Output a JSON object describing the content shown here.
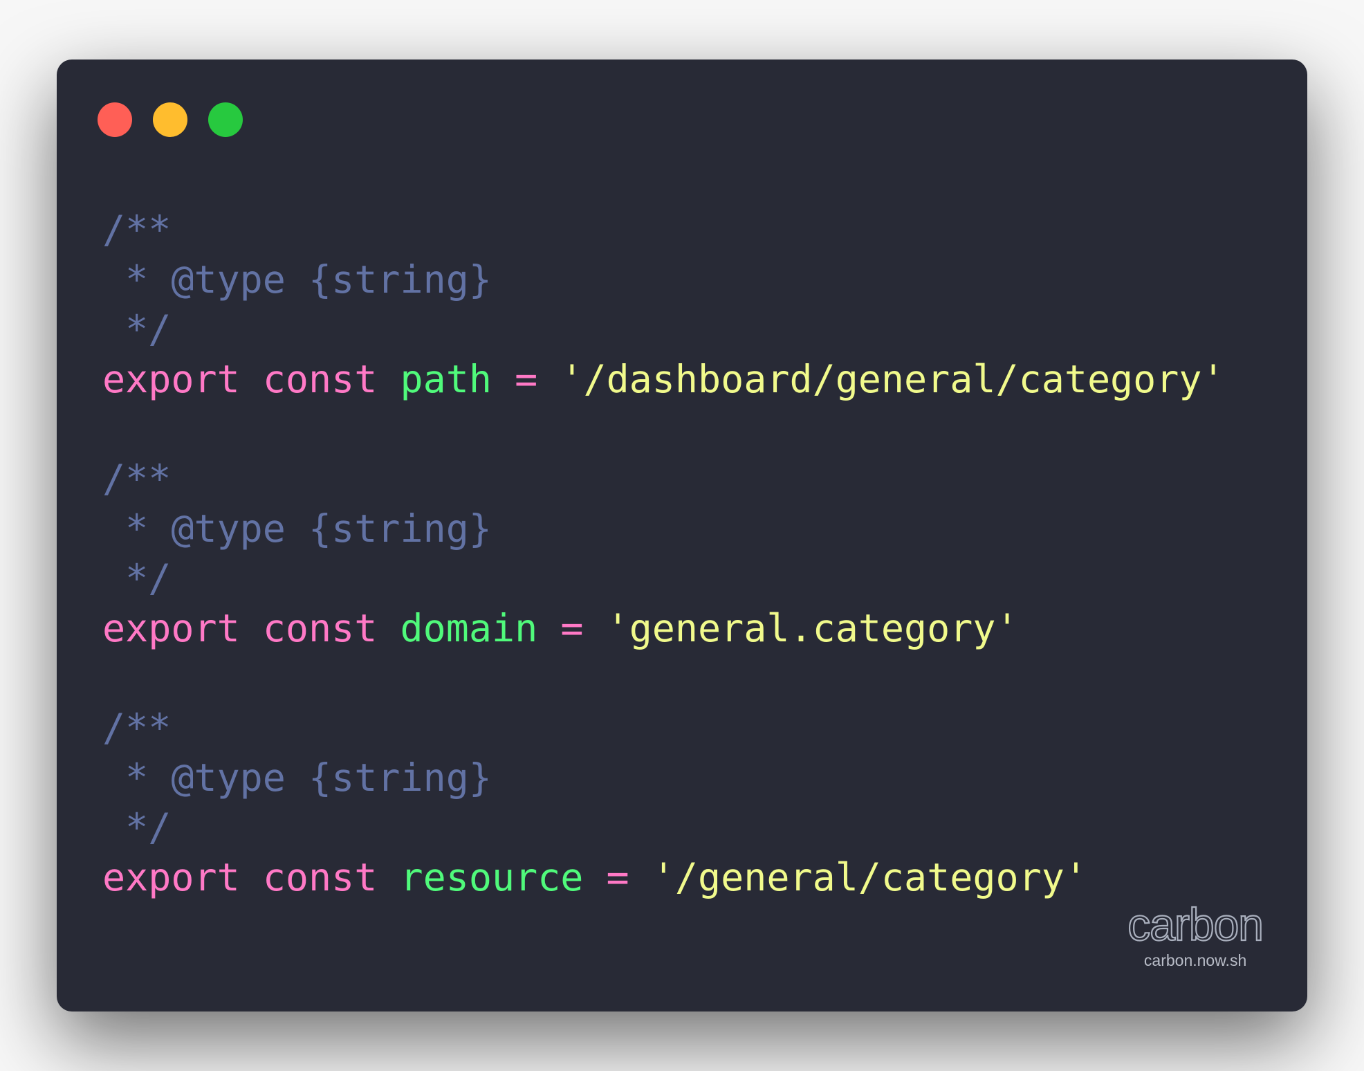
{
  "window": {
    "controls": [
      {
        "name": "close",
        "color": "#ff5f56"
      },
      {
        "name": "minimize",
        "color": "#ffbd2e"
      },
      {
        "name": "maximize",
        "color": "#27c93f"
      }
    ]
  },
  "theme": {
    "comment": "#6272a4",
    "keyword": "#ff79c6",
    "variable": "#50fa7b",
    "operator": "#ff79c6",
    "string": "#f1fa8c",
    "plain": "#f8f8f2"
  },
  "code": {
    "language": "javascript",
    "lines": [
      [
        {
          "t": "/**",
          "k": "comment"
        }
      ],
      [
        {
          "t": " * @type {string}",
          "k": "comment"
        }
      ],
      [
        {
          "t": " */",
          "k": "comment"
        }
      ],
      [
        {
          "t": "export",
          "k": "keyword"
        },
        {
          "t": " ",
          "k": "plain"
        },
        {
          "t": "const",
          "k": "keyword"
        },
        {
          "t": " ",
          "k": "plain"
        },
        {
          "t": "path",
          "k": "variable"
        },
        {
          "t": " ",
          "k": "plain"
        },
        {
          "t": "=",
          "k": "operator"
        },
        {
          "t": " ",
          "k": "plain"
        },
        {
          "t": "'/dashboard/general/category'",
          "k": "string"
        }
      ],
      [],
      [
        {
          "t": "/**",
          "k": "comment"
        }
      ],
      [
        {
          "t": " * @type {string}",
          "k": "comment"
        }
      ],
      [
        {
          "t": " */",
          "k": "comment"
        }
      ],
      [
        {
          "t": "export",
          "k": "keyword"
        },
        {
          "t": " ",
          "k": "plain"
        },
        {
          "t": "const",
          "k": "keyword"
        },
        {
          "t": " ",
          "k": "plain"
        },
        {
          "t": "domain",
          "k": "variable"
        },
        {
          "t": " ",
          "k": "plain"
        },
        {
          "t": "=",
          "k": "operator"
        },
        {
          "t": " ",
          "k": "plain"
        },
        {
          "t": "'general.category'",
          "k": "string"
        }
      ],
      [],
      [
        {
          "t": "/**",
          "k": "comment"
        }
      ],
      [
        {
          "t": " * @type {string}",
          "k": "comment"
        }
      ],
      [
        {
          "t": " */",
          "k": "comment"
        }
      ],
      [
        {
          "t": "export",
          "k": "keyword"
        },
        {
          "t": " ",
          "k": "plain"
        },
        {
          "t": "const",
          "k": "keyword"
        },
        {
          "t": " ",
          "k": "plain"
        },
        {
          "t": "resource",
          "k": "variable"
        },
        {
          "t": " ",
          "k": "plain"
        },
        {
          "t": "=",
          "k": "operator"
        },
        {
          "t": " ",
          "k": "plain"
        },
        {
          "t": "'/general/category'",
          "k": "string"
        }
      ]
    ]
  },
  "watermark": {
    "logo": "carbon",
    "url": "carbon.now.sh"
  }
}
